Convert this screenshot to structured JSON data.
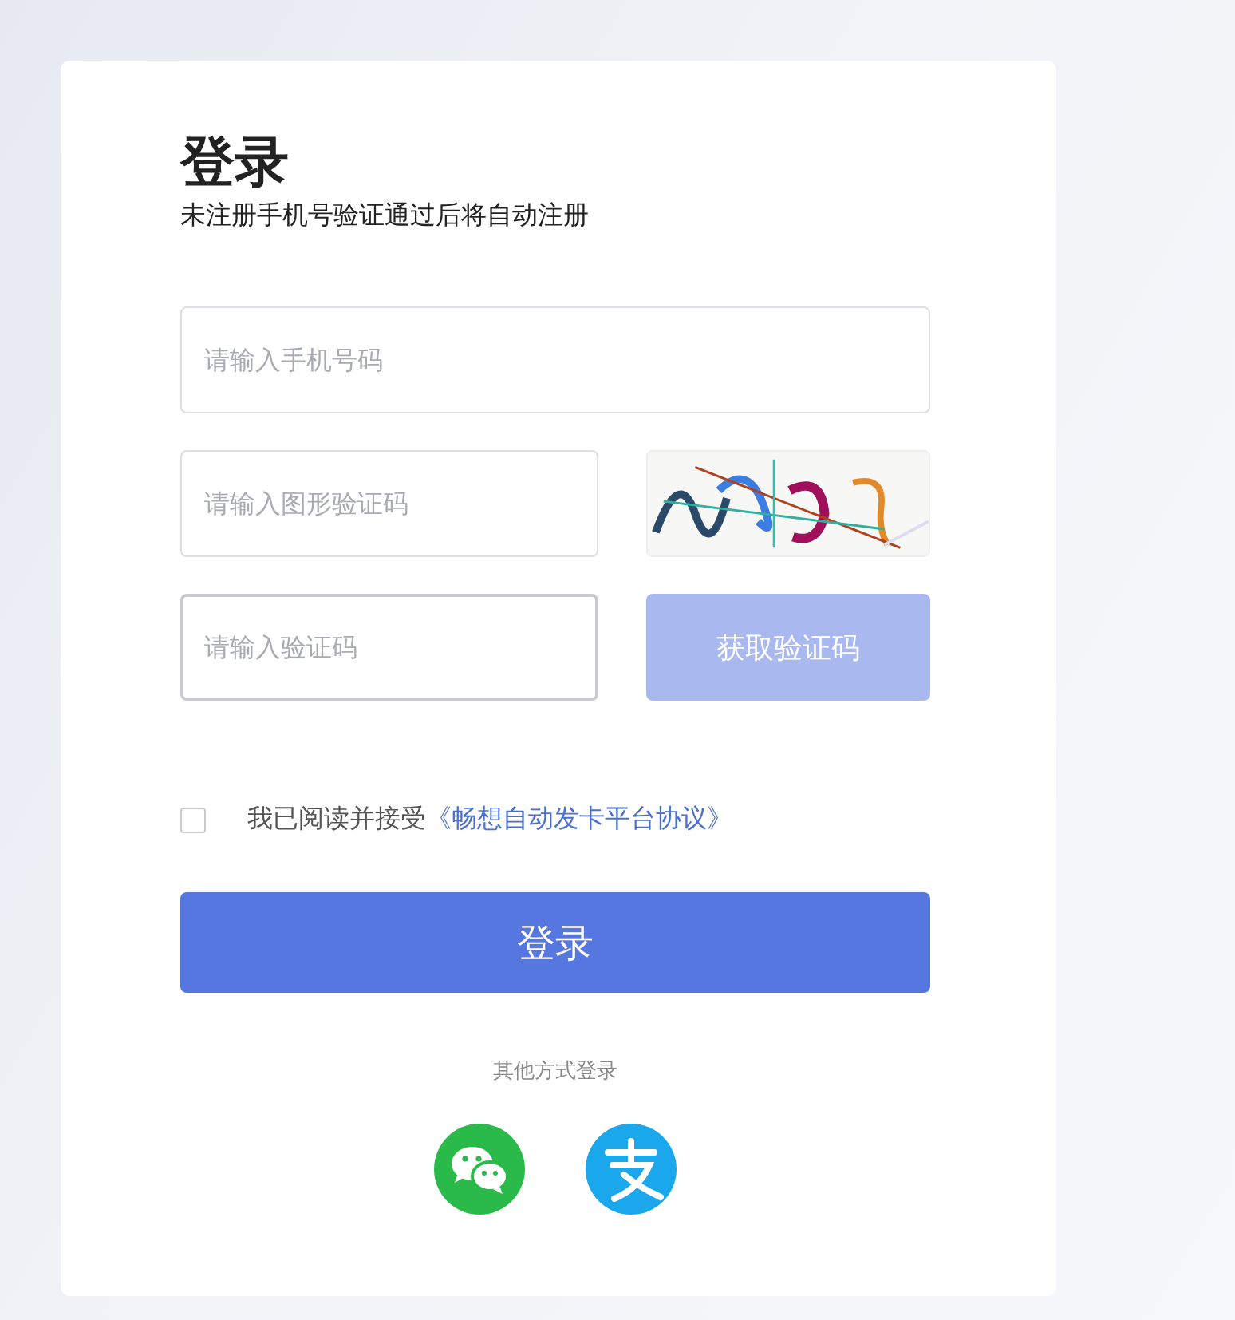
{
  "title": "登录",
  "subtitle": "未注册手机号验证通过后将自动注册",
  "fields": [
    {
      "placeholder": "请输入手机号码",
      "focused": false
    },
    {
      "placeholder": "请输入图形验证码",
      "focused": false
    },
    {
      "placeholder": "请输入验证码",
      "focused": true
    }
  ],
  "get_code_button": {
    "label": "获取验证码",
    "disabled": true
  },
  "agreement": {
    "checked": false,
    "text": "我已阅读并接受",
    "link": "《畅想自动发卡平台协议》"
  },
  "login_button": "登录",
  "other_login": "其他方式登录",
  "social": [
    {
      "kind": "wechat"
    },
    {
      "kind": "alipay"
    }
  ]
}
